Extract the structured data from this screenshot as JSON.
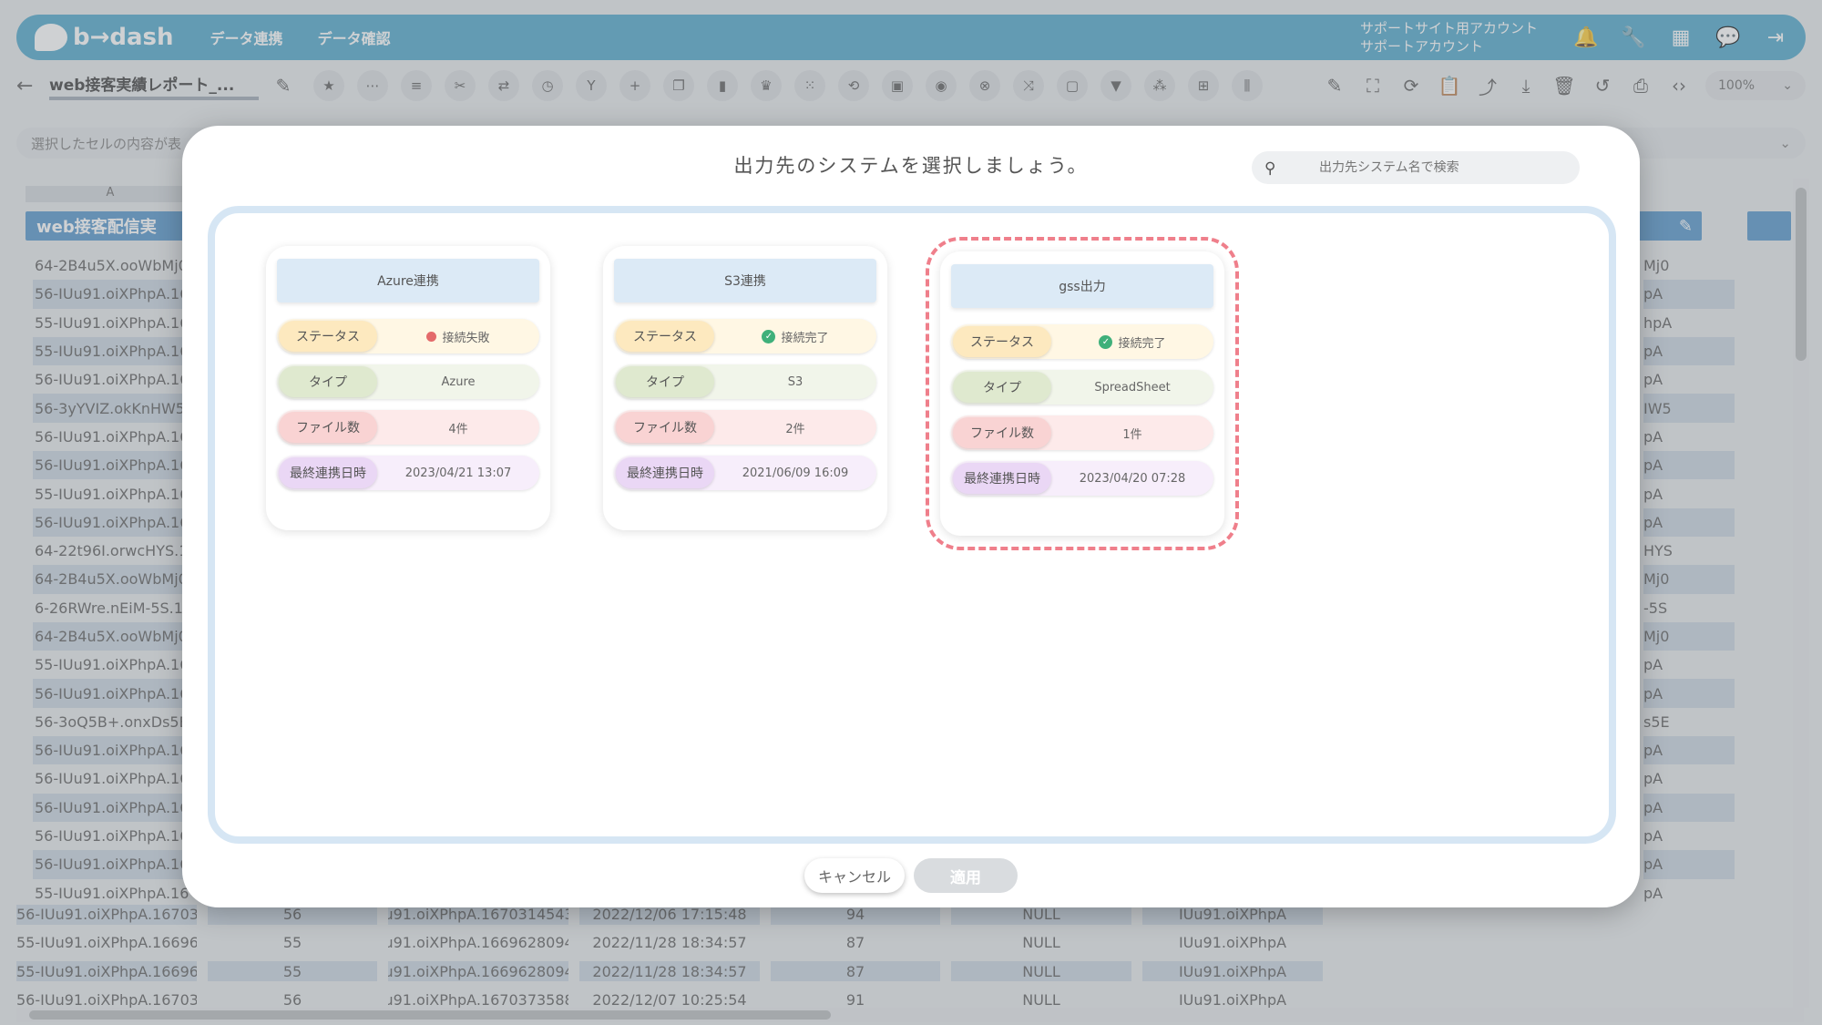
{
  "header": {
    "logo": "b→dash",
    "nav": [
      "データ連携",
      "データ確認"
    ],
    "account_line1": "サポートサイト用アカウント",
    "account_line2": "サポートアカウント"
  },
  "toolbar": {
    "doc_title": "web接客実績レポート_...",
    "zoom": "100%"
  },
  "cellbar": {
    "placeholder": "選択したセルの内容が表"
  },
  "grid": {
    "col_a": "A",
    "field_a": "web接客配信実",
    "rows_a": [
      "64-2B4u5X.ooWbMj0",
      "56-IUu91.oiXPhpA.16",
      "55-IUu91.oiXPhpA.16",
      "55-IUu91.oiXPhpA.16",
      "56-IUu91.oiXPhpA.16",
      "56-3yYVIZ.okKnHW5.",
      "56-IUu91.oiXPhpA.16",
      "56-IUu91.oiXPhpA.16",
      "55-IUu91.oiXPhpA.16",
      "56-IUu91.oiXPhpA.16",
      "64-22t96I.orwcHYS.1",
      "64-2B4u5X.ooWbMj0",
      "6-26RWre.nEiM-5S.1",
      "64-2B4u5X.ooWbMj0",
      "55-IUu91.oiXPhpA.16",
      "56-IUu91.oiXPhpA.16",
      "56-3oQ5B+.onxDs5E.",
      "56-IUu91.oiXPhpA.16",
      "56-IUu91.oiXPhpA.16",
      "56-IUu91.oiXPhpA.16",
      "56-IUu91.oiXPhpA.16",
      "56-IUu91.oiXPhpA.16",
      "55-IUu91.oiXPhpA.16"
    ],
    "rows_r": [
      "Mj0",
      "pA",
      "hpA",
      "pA",
      "pA",
      "IW5",
      "pA",
      "pA",
      "pA",
      "pA",
      "HYS",
      "Mj0",
      "-5S",
      "Mj0",
      "pA",
      "pA",
      "s5E",
      "pA",
      "pA",
      "pA",
      "pA",
      "pA",
      "pA"
    ],
    "bottom_rows": [
      [
        "56-IUu91.oiXPhpA.16703145...",
        "56",
        "IUu91.oiXPhpA.1670314543...",
        "2022/12/06 17:15:48",
        "94",
        "NULL",
        "IUu91.oiXPhpA"
      ],
      [
        "55-IUu91.oiXPhpA.16696280...",
        "55",
        "IUu91.oiXPhpA.1669628094...",
        "2022/11/28 18:34:57",
        "87",
        "NULL",
        "IUu91.oiXPhpA"
      ],
      [
        "55-IUu91.oiXPhpA.16696280...",
        "55",
        "IUu91.oiXPhpA.1669628094...",
        "2022/11/28 18:34:57",
        "87",
        "NULL",
        "IUu91.oiXPhpA"
      ],
      [
        "56-IUu91.oiXPhpA.16703735...",
        "56",
        "IUu91.oiXPhpA.1670373588...",
        "2022/12/07 10:25:54",
        "91",
        "NULL",
        "IUu91.oiXPhpA"
      ]
    ]
  },
  "modal": {
    "title": "出力先のシステムを選択しましょう。",
    "search_placeholder": "出力先システム名で検索",
    "labels": {
      "status": "ステータス",
      "type": "タイプ",
      "files": "ファイル数",
      "last_sync": "最終連携日時"
    },
    "cards": [
      {
        "name": "Azure連携",
        "status": "接続失敗",
        "status_ok": false,
        "type": "Azure",
        "files": "4件",
        "last_sync": "2023/04/21 13:07"
      },
      {
        "name": "S3連携",
        "status": "接続完了",
        "status_ok": true,
        "type": "S3",
        "files": "2件",
        "last_sync": "2021/06/09 16:09"
      },
      {
        "name": "gss出力",
        "status": "接続完了",
        "status_ok": true,
        "type": "SpreadSheet",
        "files": "1件",
        "last_sync": "2023/04/20 07:28",
        "selected": true
      }
    ],
    "cancel_label": "キャンセル",
    "apply_label": "適用"
  },
  "colors": {
    "header_bg": "#46a3c8",
    "selected_outline": "#ef7f8b",
    "ok": "#3fb07a",
    "fail": "#e46a6a"
  }
}
